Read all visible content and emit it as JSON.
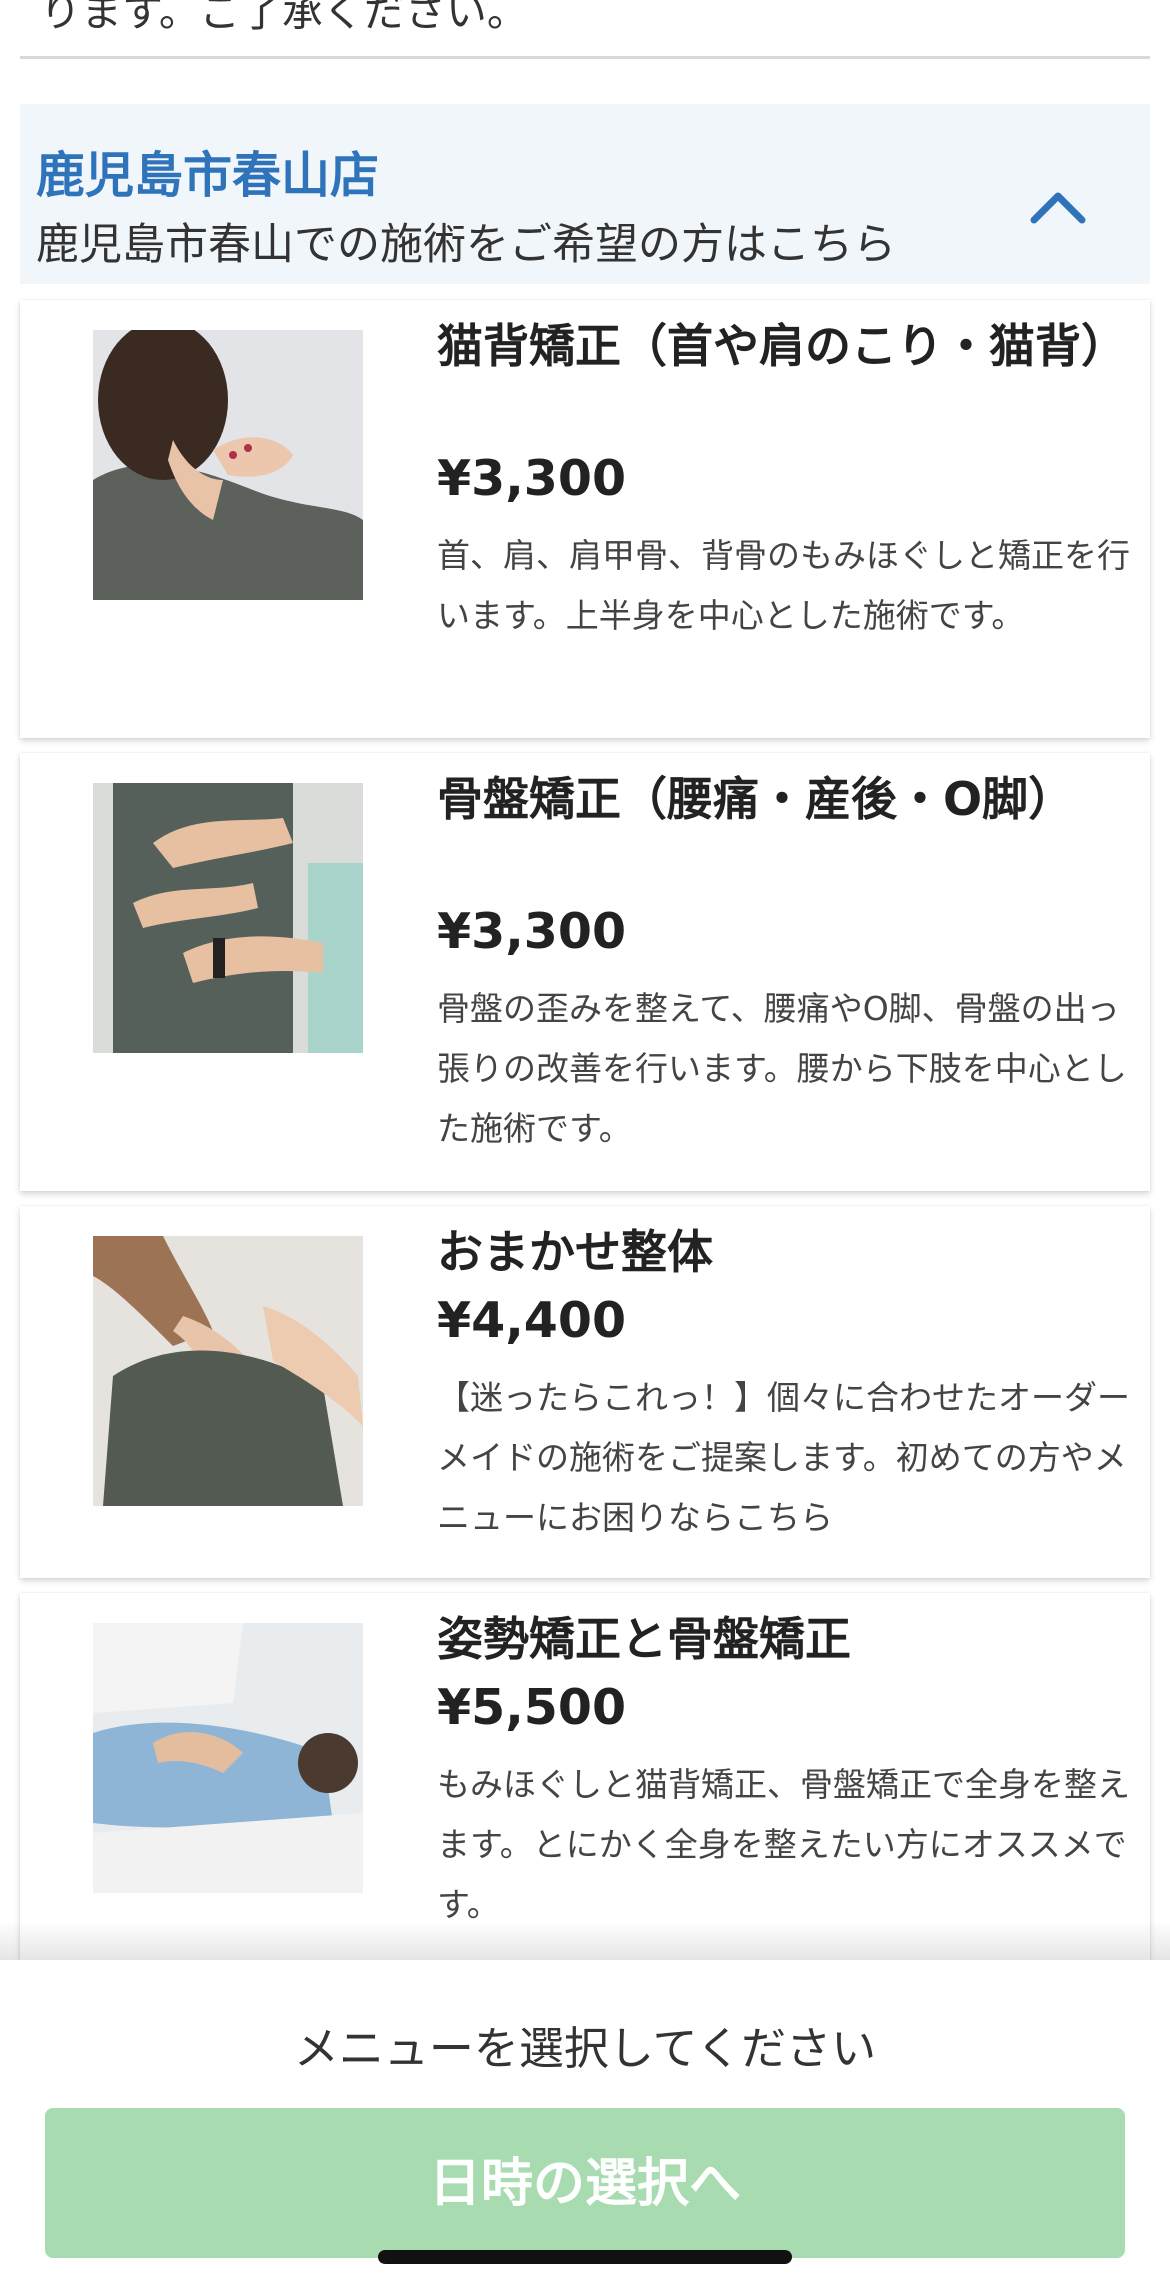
{
  "top_notice": "ります。ご了承ください。",
  "store": {
    "name": "鹿児島市春山店",
    "description": "鹿児島市春山での施術をご希望の方はこちら"
  },
  "menu_items": [
    {
      "title": "猫背矯正（首や肩のこり・猫背）",
      "price": "¥3,300",
      "description": "首、肩、肩甲骨、背骨のもみほぐしと矯正を行います。上半身を中心とした施術です。"
    },
    {
      "title": "骨盤矯正（腰痛・産後・O脚）",
      "price": "¥3,300",
      "description": "骨盤の歪みを整えて、腰痛やO脚、骨盤の出っ張りの改善を行います。腰から下肢を中心とした施術です。"
    },
    {
      "title": "おまかせ整体",
      "price": "¥4,400",
      "description": "【迷ったらこれっ！】個々に合わせたオーダーメイドの施術をご提案します。初めての方やメニューにお困りならこちら"
    },
    {
      "title": "姿勢矯正と骨盤矯正",
      "price": "¥5,500",
      "description": "もみほぐしと猫背矯正、骨盤矯正で全身を整えます。とにかく全身を整えたい方にオススメです。"
    }
  ],
  "footer": {
    "prompt": "メニューを選択してください",
    "next_button": "日時の選択へ"
  },
  "colors": {
    "accent": "#2f74ba",
    "button_disabled": "#a8dcb0",
    "header_bg": "#f1f6fa"
  },
  "icons": {
    "collapse": "chevron-up-icon"
  }
}
